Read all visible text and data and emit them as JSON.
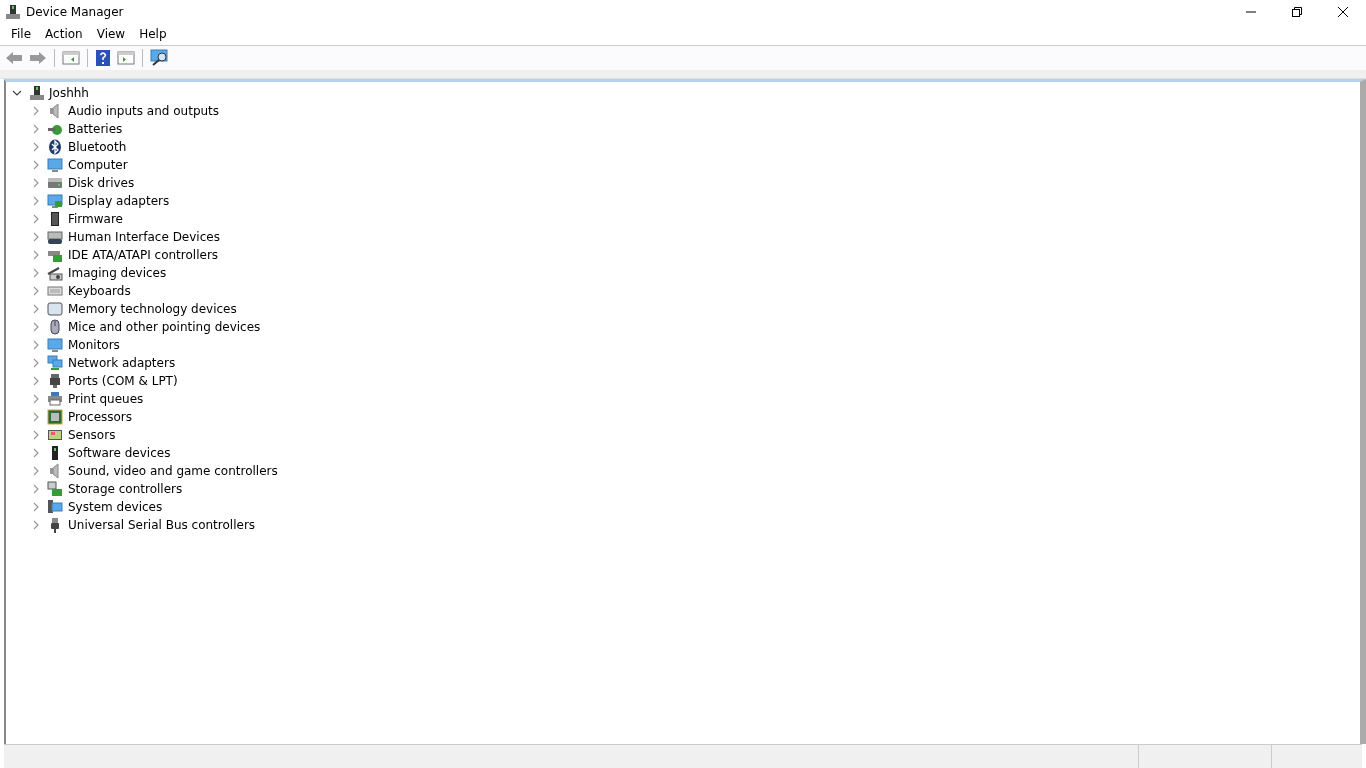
{
  "window": {
    "title": "Device Manager"
  },
  "menu": [
    "File",
    "Action",
    "View",
    "Help"
  ],
  "tree": {
    "label": "Joshhh",
    "expanded": true,
    "children": [
      {
        "label": "Audio inputs and outputs",
        "expanded": false
      },
      {
        "label": "Batteries",
        "expanded": false
      },
      {
        "label": "Bluetooth",
        "expanded": false
      },
      {
        "label": "Computer",
        "expanded": false
      },
      {
        "label": "Disk drives",
        "expanded": false
      },
      {
        "label": "Display adapters",
        "expanded": false
      },
      {
        "label": "Firmware",
        "expanded": false
      },
      {
        "label": "Human Interface Devices",
        "expanded": false
      },
      {
        "label": "IDE ATA/ATAPI controllers",
        "expanded": false
      },
      {
        "label": "Imaging devices",
        "expanded": false
      },
      {
        "label": "Keyboards",
        "expanded": false
      },
      {
        "label": "Memory technology devices",
        "expanded": false
      },
      {
        "label": "Mice and other pointing devices",
        "expanded": false
      },
      {
        "label": "Monitors",
        "expanded": false
      },
      {
        "label": "Network adapters",
        "expanded": false
      },
      {
        "label": "Ports (COM & LPT)",
        "expanded": false
      },
      {
        "label": "Print queues",
        "expanded": false
      },
      {
        "label": "Processors",
        "expanded": false
      },
      {
        "label": "Sensors",
        "expanded": false
      },
      {
        "label": "Software devices",
        "expanded": false
      },
      {
        "label": "Sound, video and game controllers",
        "expanded": false
      },
      {
        "label": "Storage controllers",
        "expanded": false
      },
      {
        "label": "System devices",
        "expanded": false
      },
      {
        "label": "Universal Serial Bus controllers",
        "expanded": false
      }
    ]
  }
}
